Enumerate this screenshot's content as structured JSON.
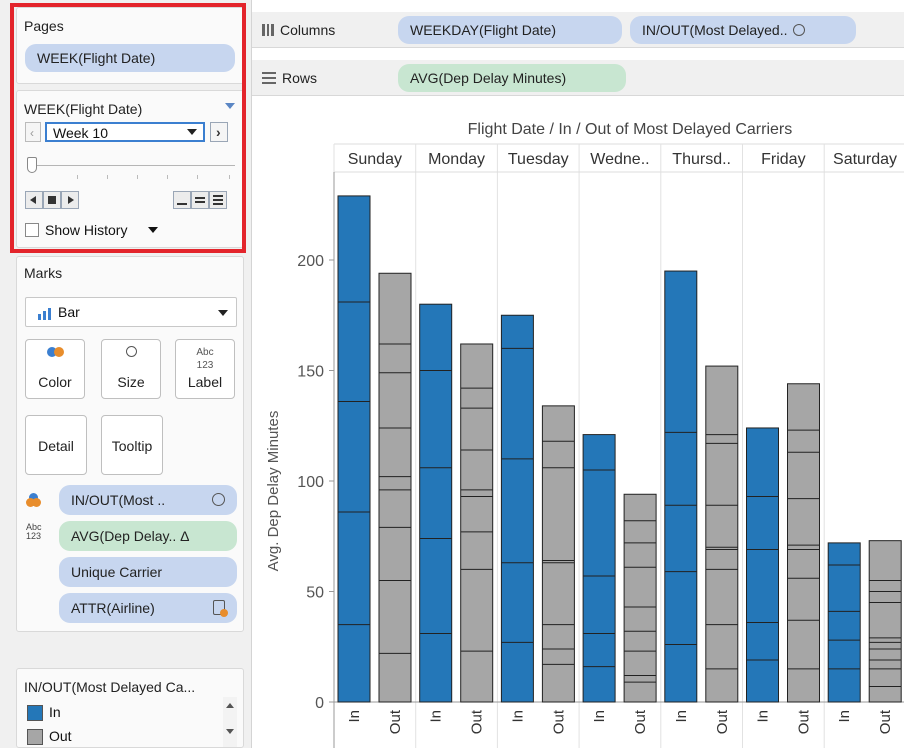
{
  "pages_card": {
    "title": "Pages",
    "pill": "WEEK(Flight Date)"
  },
  "filter_card": {
    "title": "WEEK(Flight Date)",
    "selected_week": "Week 10",
    "show_history": "Show History"
  },
  "shelves": {
    "columns_label": "Columns",
    "columns_pills": [
      "WEEKDAY(Flight Date)",
      "IN/OUT(Most Delayed.."
    ],
    "rows_label": "Rows",
    "rows_pill": "AVG(Dep Delay Minutes)"
  },
  "marks_card": {
    "title": "Marks",
    "mark_type": "Bar",
    "tiles": [
      "Color",
      "Size",
      "Label",
      "Detail",
      "Tooltip"
    ],
    "label_icon_text": "Abc 123",
    "encodings": [
      {
        "text": "IN/OUT(Most ..",
        "icon": "color-icon",
        "trailing": "set-icon"
      },
      {
        "text": "AVG(Dep Delay.. Δ",
        "icon": "abc-123-icon",
        "trailing": ""
      },
      {
        "text": "Unique Carrier",
        "icon": "",
        "trailing": ""
      },
      {
        "text": "ATTR(Airline)",
        "icon": "",
        "trailing": "attr-icon"
      }
    ]
  },
  "legend_card": {
    "title": "IN/OUT(Most Delayed Ca...",
    "items": [
      {
        "label": "In",
        "color": "#2477b8"
      },
      {
        "label": "Out",
        "color": "#a6a6a6"
      }
    ]
  },
  "chart_data": {
    "type": "bar",
    "title": "Flight Date  /  In / Out of Most Delayed Carriers",
    "ylabel": "Avg. Dep Delay Minutes",
    "ylim": [
      0,
      235
    ],
    "yticks": [
      0,
      50,
      100,
      150,
      200
    ],
    "categories": [
      "Sunday",
      "Monday",
      "Tuesday",
      "Wedne..",
      "Thursd..",
      "Friday",
      "Saturday"
    ],
    "subcategories": [
      "In",
      "Out"
    ],
    "colors": {
      "In": "#2477b8",
      "Out": "#a6a6a6"
    },
    "series": [
      {
        "name": "In",
        "values": [
          229,
          180,
          175,
          121,
          195,
          124,
          72
        ],
        "segments": [
          [
            35,
            86,
            136,
            181,
            229
          ],
          [
            31,
            74,
            106,
            150,
            180
          ],
          [
            27,
            63,
            110,
            160,
            175
          ],
          [
            16,
            31,
            57,
            105,
            121
          ],
          [
            26,
            59,
            89,
            122,
            195
          ],
          [
            19,
            36,
            69,
            93,
            124
          ],
          [
            15,
            28,
            41,
            62,
            72
          ]
        ]
      },
      {
        "name": "Out",
        "values": [
          194,
          162,
          134,
          94,
          152,
          144,
          73
        ],
        "segments": [
          [
            22,
            55,
            79,
            96,
            102,
            124,
            149,
            162,
            194
          ],
          [
            23,
            60,
            77,
            93,
            96,
            114,
            133,
            142,
            162
          ],
          [
            17,
            24,
            35,
            63,
            64,
            106,
            118,
            134
          ],
          [
            9,
            12,
            23,
            32,
            43,
            61,
            72,
            82,
            94
          ],
          [
            15,
            35,
            60,
            69,
            70,
            89,
            117,
            121,
            152
          ],
          [
            15,
            37,
            56,
            69,
            71,
            92,
            113,
            123,
            144
          ],
          [
            7,
            15,
            19,
            24,
            27,
            29,
            45,
            50,
            55,
            73
          ]
        ]
      }
    ],
    "grid": false,
    "legend": "left-panel"
  }
}
